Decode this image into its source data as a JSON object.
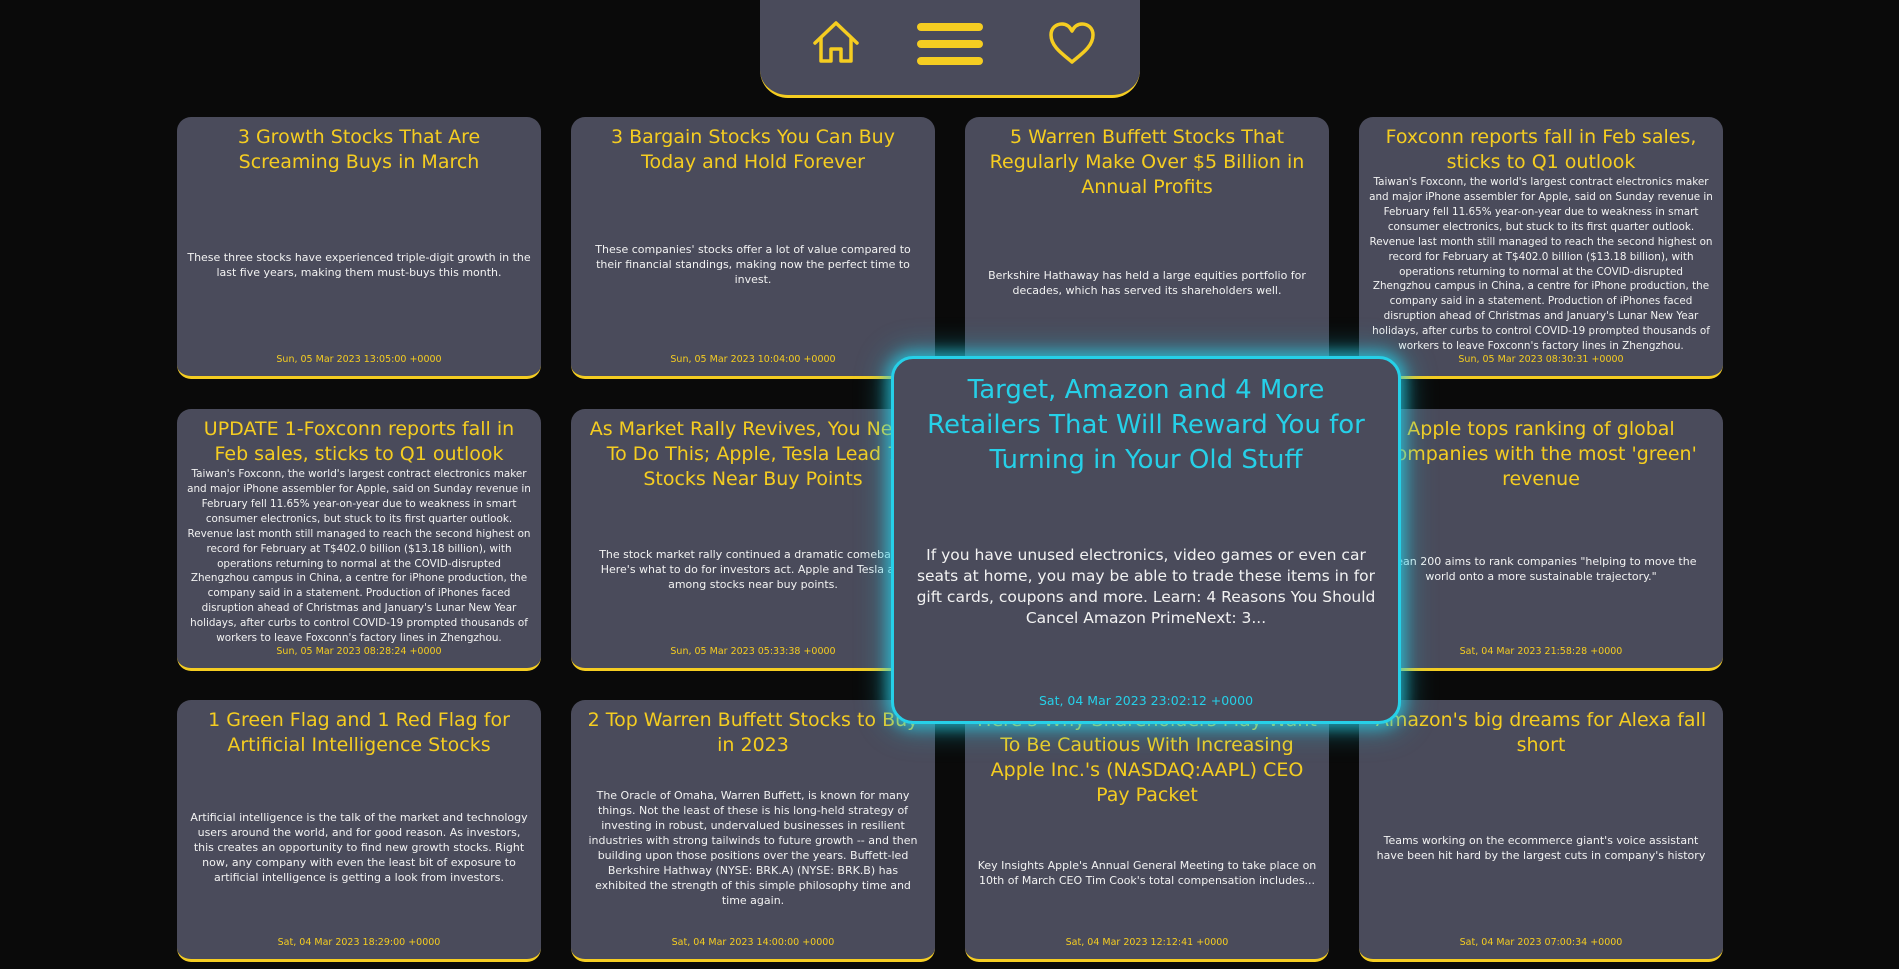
{
  "nav": {
    "items": [
      {
        "icon": "home-icon"
      },
      {
        "icon": "menu-icon"
      },
      {
        "icon": "heart-icon"
      }
    ],
    "colors": {
      "accent": "#f5cd21",
      "surface": "#4a4b5b",
      "focus": "#26d0e8",
      "background": "#0a0a0a"
    }
  },
  "cards": [
    {
      "title": "3 Growth Stocks That Are Screaming Buys in March",
      "description": "These three stocks have experienced triple-digit growth in the last five years, making them must-buys this month.",
      "date": "Sun, 05 Mar 2023 13:05:00 +0000"
    },
    {
      "title": "3 Bargain Stocks You Can Buy Today and Hold Forever",
      "description": "These companies' stocks offer a lot of value compared to their financial standings, making now the perfect time to invest.",
      "date": "Sun, 05 Mar 2023 10:04:00 +0000"
    },
    {
      "title": "5 Warren Buffett Stocks That Regularly Make Over $5 Billion in Annual Profits",
      "description": "Berkshire Hathaway has held a large equities portfolio for decades, which has served its shareholders well.",
      "date": ""
    },
    {
      "title": "Foxconn reports fall in Feb sales, sticks to Q1 outlook",
      "description": "Taiwan's Foxconn, the world's largest contract electronics maker and major iPhone assembler for Apple, said on Sunday revenue in February fell 11.65% year-on-year due to weakness in smart consumer electronics, but stuck to its first quarter outlook. Revenue last month still managed to reach the second highest on record for February at T$402.0 billion ($13.18 billion), with operations returning to normal at the COVID-disrupted Zhengzhou campus in China, a centre for iPhone production, the company said in a statement. Production of iPhones faced disruption ahead of Christmas and January's Lunar New Year holidays, after curbs to control COVID-19 prompted thousands of workers to leave Foxconn's factory lines in Zhengzhou.",
      "date": "Sun, 05 Mar 2023 08:30:31 +0000"
    },
    {
      "title": "UPDATE 1-Foxconn reports fall in Feb sales, sticks to Q1 outlook",
      "description": "Taiwan's Foxconn, the world's largest contract electronics maker and major iPhone assembler for Apple, said on Sunday revenue in February fell 11.65% year-on-year due to weakness in smart consumer electronics, but stuck to its first quarter outlook. Revenue last month still managed to reach the second highest on record for February at T$402.0 billion ($13.18 billion), with operations returning to normal at the COVID-disrupted Zhengzhou campus in China, a centre for iPhone production, the company said in a statement. Production of iPhones faced disruption ahead of Christmas and January's Lunar New Year holidays, after curbs to control COVID-19 prompted thousands of workers to leave Foxconn's factory lines in Zhengzhou.",
      "date": "Sun, 05 Mar 2023 08:28:24 +0000"
    },
    {
      "title": "As Market Rally Revives, You Need To Do This; Apple, Tesla Lead 7 Stocks Near Buy Points",
      "description": "The stock market rally continued a dramatic comeback. Here's what to do for investors act. Apple and Tesla are among stocks near buy points.",
      "date": "Sun, 05 Mar 2023 05:33:38 +0000"
    },
    {
      "title": "",
      "description": "",
      "date": ""
    },
    {
      "title": "Apple tops ranking of global companies with the most 'green' revenue",
      "description": "Clean 200 aims to rank companies \"helping to move the world onto a more sustainable trajectory.\"",
      "date": "Sat, 04 Mar 2023 21:58:28 +0000"
    },
    {
      "title": "1 Green Flag and 1 Red Flag for Artificial Intelligence Stocks",
      "description": "Artificial intelligence is the talk of the market and technology users around the world, and for good reason. As investors, this creates an opportunity to find new growth stocks. Right now, any company with even the least bit of exposure to artificial intelligence is getting a look from investors.",
      "date": "Sat, 04 Mar 2023 18:29:00 +0000"
    },
    {
      "title": "2 Top Warren Buffett Stocks to Buy in 2023",
      "description": "The Oracle of Omaha, Warren Buffett, is known for many things. Not the least of these is his long-held strategy of investing in robust, undervalued businesses in resilient industries with strong tailwinds to future growth -- and then building upon those positions over the years. Buffett-led Berkshire Hathway (NYSE: BRK.A) (NYSE: BRK.B) has exhibited the strength of this simple philosophy time and time again.",
      "date": "Sat, 04 Mar 2023 14:00:00 +0000"
    },
    {
      "title": "Here's Why Shareholders May Want To Be Cautious With Increasing Apple Inc.'s (NASDAQ:AAPL) CEO Pay Packet",
      "description": "Key Insights Apple's Annual General Meeting to take place on 10th of March CEO Tim Cook's total compensation includes...",
      "date": "Sat, 04 Mar 2023 12:12:41 +0000"
    },
    {
      "title": "Amazon's big dreams for Alexa fall short",
      "description": "Teams working on the ecommerce giant's voice assistant have been hit hard by the largest cuts in company's history",
      "date": "Sat, 04 Mar 2023 07:00:34 +0000"
    }
  ],
  "focused_card": {
    "title": "Target, Amazon and 4 More Retailers That Will Reward You for Turning in Your Old Stuff",
    "description": "If you have unused electronics, video games or even car seats at home, you may be able to trade these items in for gift cards, coupons and more. Learn: 4 Reasons You Should Cancel Amazon PrimeNext: 3...",
    "date": "Sat, 04 Mar 2023 23:02:12 +0000"
  }
}
